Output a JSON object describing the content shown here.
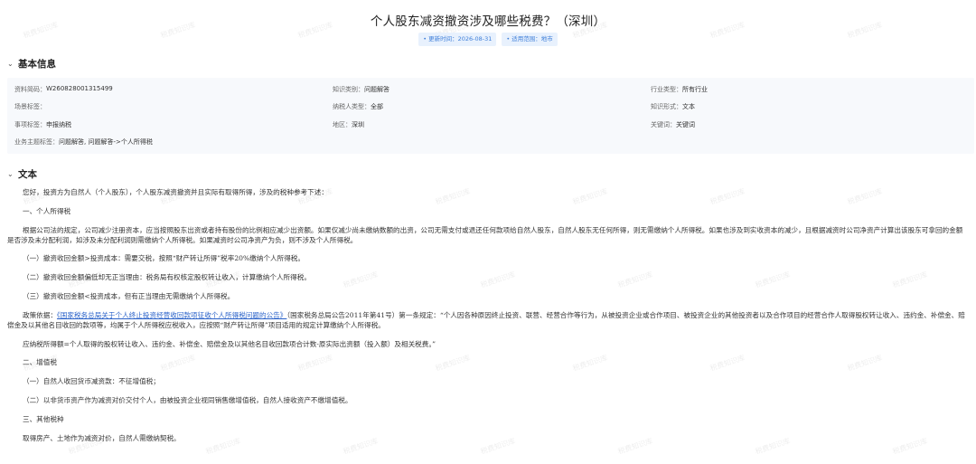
{
  "page": {
    "title": "个人股东减资撤资涉及哪些税费？（深圳）",
    "tags": [
      "• 更新时间：2026-08-31",
      "• 适用范围：地市"
    ]
  },
  "watermark": "税费知识库",
  "basic": {
    "heading": "基本信息",
    "rows": [
      [
        {
          "label": "资料简码：",
          "value": "W260828001315499"
        },
        {
          "label": "知识类别：",
          "value": "问题解答"
        },
        {
          "label": "行业类型：",
          "value": "所有行业"
        }
      ],
      [
        {
          "label": "场景标签：",
          "value": ""
        },
        {
          "label": "纳税人类型：",
          "value": "全部"
        },
        {
          "label": "知识形式：",
          "value": "文本"
        }
      ],
      [
        {
          "label": "事项标签：",
          "value": "申报纳税"
        },
        {
          "label": "地区：",
          "value": "深圳"
        },
        {
          "label": "关键词：",
          "value": "关键词"
        }
      ],
      [
        {
          "label": "业务主题标签：",
          "value": "问题解答, 问题解答->个人所得税"
        }
      ]
    ]
  },
  "text_section": {
    "heading": "文本",
    "p1": "您好，投资方为自然人（个人股东），个人股东减资撤资并且实际有取得所得，涉及的税种参考下述：",
    "p2": "一、个人所得税",
    "p3": "根据公司法的规定，公司减少注册资本，应当按照股东出资或者持有股份的比例相应减少出资额。如果仅减少尚未缴纳数额的出资，公司无需支付或退还任何款项给自然人股东，自然人股东无任何所得，则无需缴纳个人所得税。如果也涉及到实收资本的减少，且根据减资时公司净资产计算出该股东可拿回的金额是否涉及未分配利润，如涉及未分配利润则需缴纳个人所得税。如果减资时公司净资产为负，则不涉及个人所得税。",
    "p4": "（一）撤资收回金额>投资成本：需要交税，按照“财产转让所得”税率20%缴纳个人所得税。",
    "p5": "（二）撤资收回金额偏低却无正当理由：税务局有权核定股权转让收入，计算缴纳个人所得税。",
    "p6": "（三）撤资收回金额<投资成本，但有正当理由无需缴纳个人所得税。",
    "p7_prefix": "政策依据：",
    "p7_link": "《国家税务总局关于个人终止投资经营收回款项征收个人所得税问题的公告》",
    "p7_rest": "（国家税务总局公告2011年第41号）第一条规定：“个人因各种原因终止投资、联营、经营合作等行为，从被投资企业或合作项目、被投资企业的其他投资者以及合作项目的经营合作人取得股权转让收入、违约金、补偿金、赔偿金及以其他名目收回的款项等，均属于个人所得税应税收入，应按照“财产转让所得”项目适用的规定计算缴纳个人所得税。",
    "p8": "应纳税所得额=个人取得的股权转让收入、违约金、补偿金、赔偿金及以其他名目收回款项合计数-原实际出资额（投入额）及相关税费。”",
    "p9": "二、增值税",
    "p10": "（一）自然人收回货币减资款：不征增值税；",
    "p11": "（二）以非货币资产作为减资对价交付个人，由被投资企业视同销售缴增值税，自然人接收资产不缴增值税。",
    "p12": "三、其他税种",
    "p13": "取得房产、土地作为减资对价，自然人需缴纳契税。"
  }
}
